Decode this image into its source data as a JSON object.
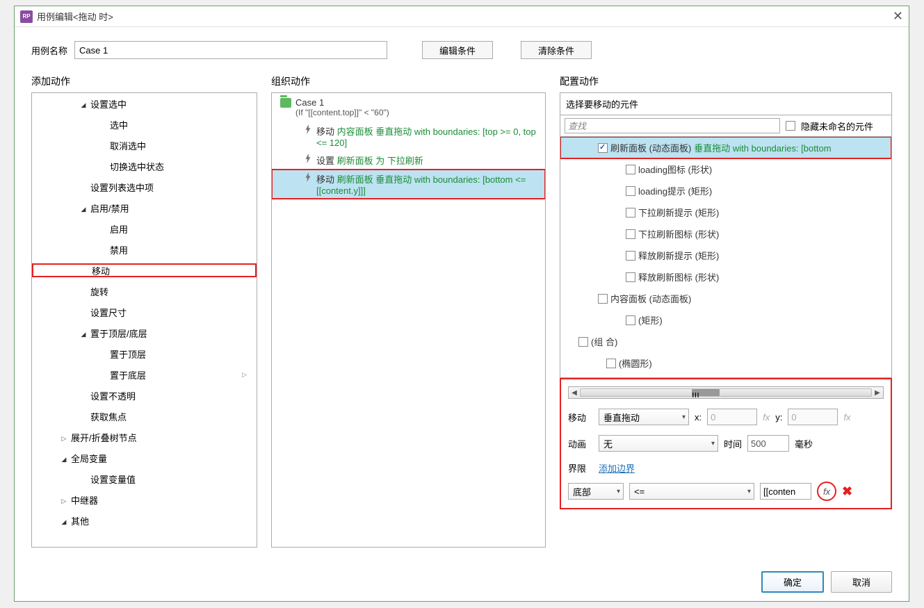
{
  "titlebar": {
    "logo": "RP",
    "title": "用例编辑<拖动 时>"
  },
  "namerow": {
    "label": "用例名称",
    "value": "Case 1",
    "edit_cond": "编辑条件",
    "clear_cond": "清除条件"
  },
  "columns": {
    "left": "添加动作",
    "mid": "组织动作",
    "right": "配置动作"
  },
  "left_tree": [
    {
      "l": 1,
      "t": "down",
      "label": "设置选中"
    },
    {
      "l": 2,
      "label": "选中"
    },
    {
      "l": 2,
      "label": "取消选中"
    },
    {
      "l": 2,
      "label": "切换选中状态"
    },
    {
      "l": 1,
      "label": "设置列表选中项"
    },
    {
      "l": 1,
      "t": "down",
      "label": "启用/禁用"
    },
    {
      "l": 2,
      "label": "启用"
    },
    {
      "l": 2,
      "label": "禁用"
    },
    {
      "l": 1,
      "label": "移动",
      "hl": true
    },
    {
      "l": 1,
      "label": "旋转"
    },
    {
      "l": 1,
      "label": "设置尺寸"
    },
    {
      "l": 1,
      "t": "down",
      "label": "置于顶层/底层"
    },
    {
      "l": 2,
      "label": "置于顶层"
    },
    {
      "l": 2,
      "label": "置于底层",
      "sub": true
    },
    {
      "l": 1,
      "label": "设置不透明"
    },
    {
      "l": 1,
      "label": "获取焦点"
    },
    {
      "l": 0,
      "t": "right",
      "label": "展开/折叠树节点"
    },
    {
      "l": 0,
      "t": "down",
      "label": "全局变量"
    },
    {
      "l": 1,
      "label": "设置变量值"
    },
    {
      "l": 0,
      "t": "right",
      "label": "中继器"
    },
    {
      "l": 0,
      "t": "down",
      "label": "其他"
    }
  ],
  "case": {
    "name": "Case 1",
    "cond": "(If \"[[content.top]]\" < \"60\")",
    "actions": [
      {
        "verb": "移动 ",
        "param": "内容面板 垂直拖动 with boundaries: [top >= 0, top <= 120]"
      },
      {
        "verb": "设置 ",
        "param": "刷新面板 为 下拉刷新"
      },
      {
        "verb": "移动 ",
        "param": "刷新面板 垂直拖动 with boundaries: [bottom <= [[content.y]]]",
        "selected": true,
        "hl": true
      }
    ]
  },
  "cfg": {
    "title": "选择要移动的元件",
    "search_ph": "查找",
    "hide_unnamed": "隐藏未命名的元件",
    "widgets": [
      {
        "l": 0,
        "t": "down",
        "chk": true,
        "name": "刷新面板 (动态面板) ",
        "param": "垂直拖动 with boundaries: [bottom",
        "selected": true,
        "hl": true
      },
      {
        "l": 1,
        "chk": false,
        "name": "loading图标 (形状)"
      },
      {
        "l": 1,
        "chk": false,
        "name": "loading提示 (矩形)"
      },
      {
        "l": 1,
        "chk": false,
        "name": "下拉刷新提示 (矩形)"
      },
      {
        "l": 1,
        "chk": false,
        "name": "下拉刷新图标 (形状)"
      },
      {
        "l": 1,
        "chk": false,
        "name": "释放刷新提示 (矩形)"
      },
      {
        "l": 1,
        "chk": false,
        "name": "释放刷新图标 (形状)"
      },
      {
        "l": 0,
        "t": "down",
        "chk": false,
        "name": "内容面板 (动态面板)"
      },
      {
        "l": 1,
        "chk": false,
        "name": "(矩形)"
      },
      {
        "l": -1,
        "t": "down",
        "chk": false,
        "name": "(组 合)"
      },
      {
        "l": 0,
        "chk": false,
        "name": "(椭圆形)"
      }
    ],
    "move": {
      "label": "移动",
      "type": "垂直拖动",
      "xl": "x:",
      "x": "0",
      "yl": "y:",
      "y": "0"
    },
    "anim": {
      "label": "动画",
      "type": "无",
      "time_l": "时间",
      "time": "500",
      "unit": "毫秒"
    },
    "bound": {
      "label": "界限",
      "link": "添加边界",
      "edge": "底部",
      "op": "<=",
      "val": "[[conten",
      "fx": "fx"
    }
  },
  "footer": {
    "ok": "确定",
    "cancel": "取消"
  }
}
